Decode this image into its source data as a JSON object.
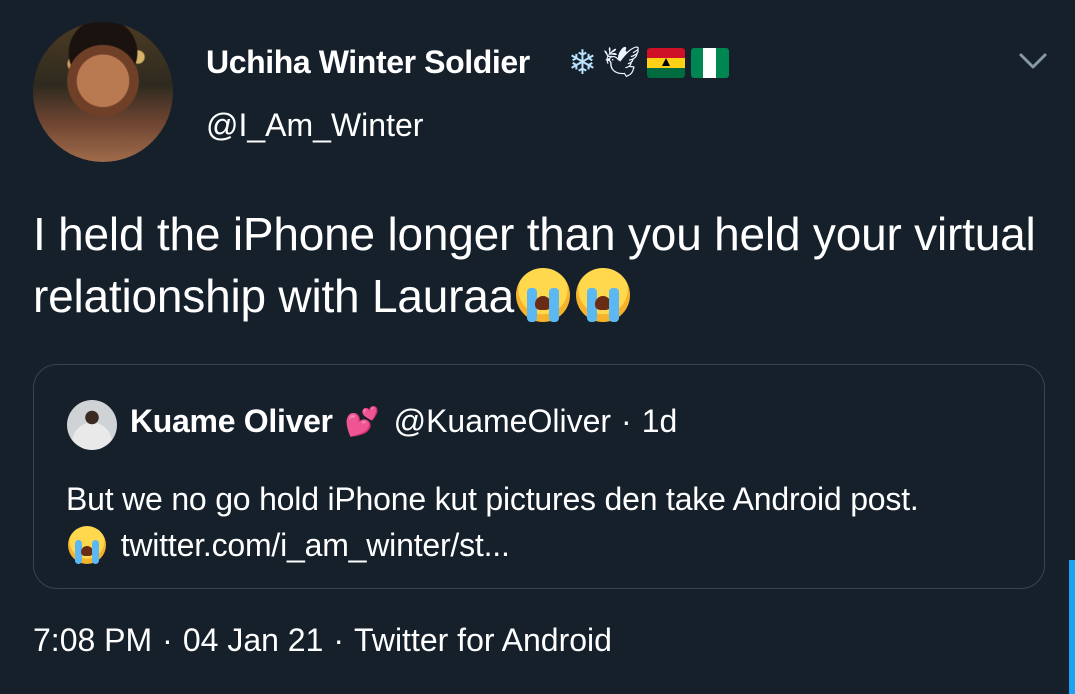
{
  "tweet": {
    "author_name": "Uchiha Winter Soldier",
    "badges": [
      "snowflake-icon",
      "dove-icon",
      "ghana-flag-icon",
      "nigeria-flag-icon"
    ],
    "handle": "@I_Am_Winter",
    "text": "I held the iPhone longer than you held your virtual relationship with Lauraa",
    "emojis": [
      "loudly-crying-face",
      "loudly-crying-face"
    ],
    "timestamp": "7:08 PM",
    "date": "04 Jan 21",
    "client": "Twitter for Android",
    "separator": "·"
  },
  "quoted_tweet": {
    "author_name": "Kuame Oliver",
    "handle": "@KuameOliver",
    "age": "1d",
    "separator": "·",
    "text": "But we no go hold iPhone kut pictures den take Android post.",
    "link": "twitter.com/i_am_winter/st..."
  },
  "colors": {
    "background": "#15202b",
    "border": "#38444d",
    "accent": "#1da1f2",
    "text": "#ffffff"
  }
}
